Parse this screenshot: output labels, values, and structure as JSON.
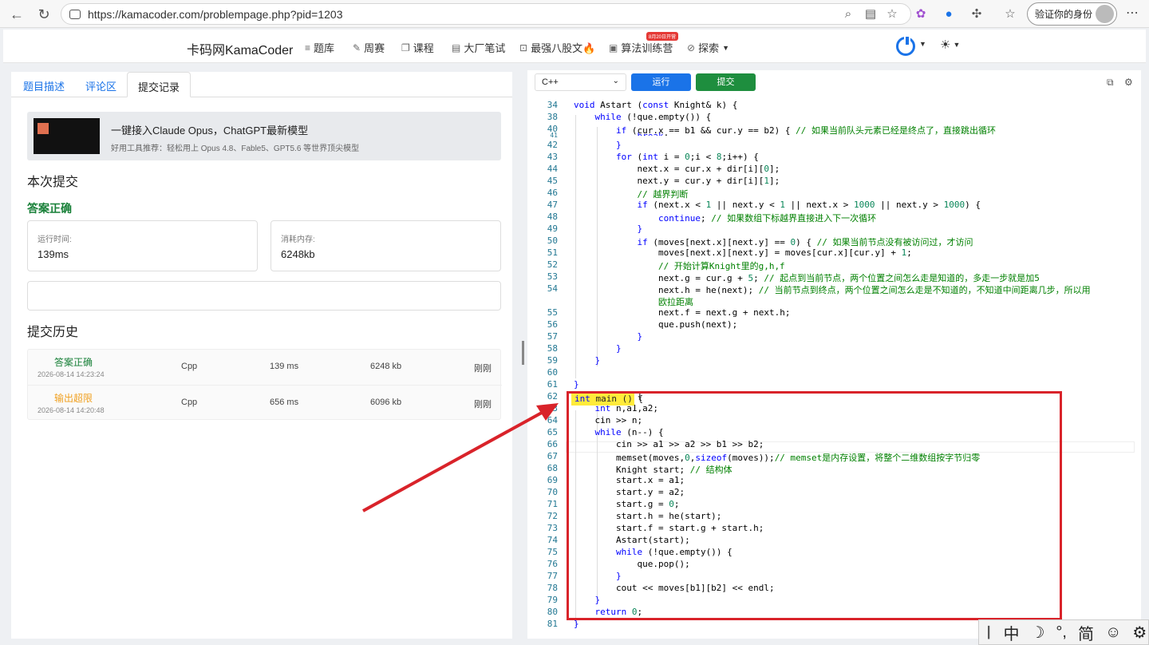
{
  "browser": {
    "url": "https://kamacoder.com/problempage.php?pid=1203",
    "verify_label": "验证你的身份"
  },
  "site": {
    "brand": "卡码网KamaCoder",
    "menu": [
      "题库",
      "周赛",
      "课程",
      "大厂笔试",
      "最强八股文🔥",
      "算法训练营",
      "探索"
    ],
    "badge": "8月20日开营"
  },
  "left": {
    "tabs": [
      "题目描述",
      "评论区",
      "提交记录"
    ],
    "ad_title": "一键接入Claude Opus，ChatGPT最新模型",
    "ad_sub": "好用工具推荐：轻松用上 Opus 4.8、Fable5、GPT5.6 等世界顶尖模型",
    "this_submit": "本次提交",
    "status": "答案正确",
    "runtime_label": "运行时间:",
    "runtime": "139ms",
    "memory_label": "消耗内存:",
    "memory": "6248kb",
    "history_title": "提交历史",
    "history": [
      {
        "status": "答案正确",
        "time": "2026-08-14 14:23:24",
        "lang": "Cpp",
        "rt": "139 ms",
        "mem": "6248 kb",
        "when": "刚刚",
        "color": "#188038"
      },
      {
        "status": "输出超限",
        "time": "2026-08-14 14:20:48",
        "lang": "Cpp",
        "rt": "656 ms",
        "mem": "6096 kb",
        "when": "刚刚",
        "color": "#f0a020"
      }
    ]
  },
  "editor": {
    "language": "C++",
    "run": "运行",
    "submit": "提交"
  },
  "ime": [
    "中",
    "☽",
    "°,",
    "简",
    "☺",
    "⚙"
  ]
}
